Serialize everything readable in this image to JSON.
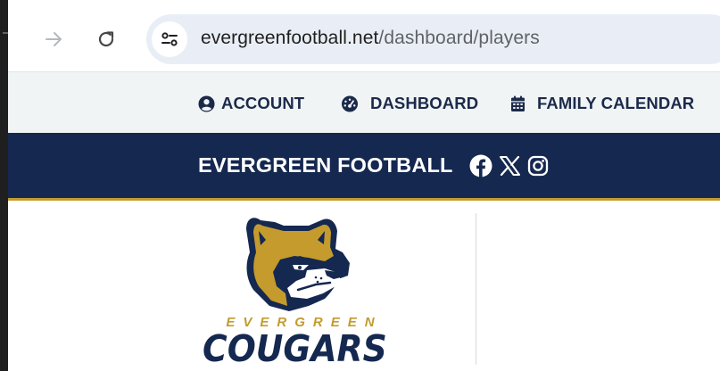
{
  "browser": {
    "url_host": "evergreenfootball.net",
    "url_path": "/dashboard/players"
  },
  "utility_nav": {
    "items": [
      {
        "label": "ACCOUNT",
        "icon": "user-circle-icon"
      },
      {
        "label": "DASHBOARD",
        "icon": "gauge-icon"
      },
      {
        "label": "FAMILY CALENDAR",
        "icon": "calendar-icon"
      }
    ]
  },
  "site": {
    "title": "EVERGREEN FOOTBALL",
    "social": [
      "facebook-icon",
      "x-icon",
      "instagram-icon"
    ]
  },
  "logo": {
    "word_small": "EVERGREEN",
    "word_big": "COUGARS"
  },
  "colors": {
    "navy": "#152850",
    "gold": "#c49b2c",
    "utility_bg": "#f0f4f5"
  }
}
